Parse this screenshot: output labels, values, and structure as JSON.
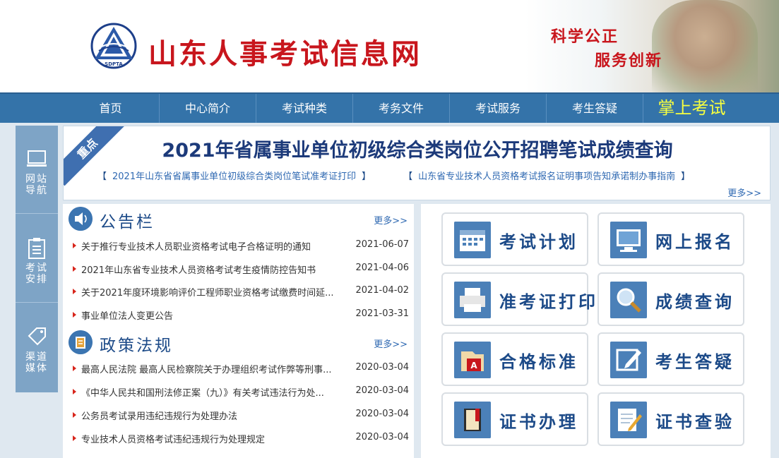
{
  "header": {
    "site_title": "山东人事考试信息网",
    "slogan_line1": "科学公正",
    "slogan_line2": "服务创新",
    "logo_text": "SDPTA"
  },
  "nav": {
    "items": [
      "首页",
      "中心简介",
      "考试种类",
      "考务文件",
      "考试服务",
      "考生答疑",
      "掌上考试"
    ]
  },
  "side": {
    "items": [
      {
        "line1": "网站",
        "line2": "导航",
        "icon": "monitor-icon"
      },
      {
        "line1": "考试",
        "line2": "安排",
        "icon": "clipboard-icon"
      },
      {
        "line1": "渠道",
        "line2": "媒体",
        "icon": "tag-icon"
      }
    ]
  },
  "headline": {
    "ribbon": "重点",
    "title": "2021年省属事业单位初级综合类岗位公开招聘笔试成绩查询",
    "link1": "2021年山东省省属事业单位初级综合类岗位笔试准考证打印",
    "link2": "山东省专业技术人员资格考试报名证明事项告知承诺制办事指南",
    "bracket_open": "【",
    "bracket_close": "】",
    "more": "更多>>"
  },
  "bulletin": {
    "title": "公告栏",
    "more": "更多>>",
    "rows": [
      {
        "title": "关于推行专业技术人员职业资格考试电子合格证明的通知",
        "date": "2021-06-07"
      },
      {
        "title": "2021年山东省专业技术人员资格考试考生疫情防控告知书",
        "date": "2021-04-06"
      },
      {
        "title": "关于2021年度环境影响评价工程师职业资格考试缴费时间延...",
        "date": "2021-04-02"
      },
      {
        "title": "事业单位法人变更公告",
        "date": "2021-03-31"
      }
    ]
  },
  "policy": {
    "title": "政策法规",
    "more": "更多>>",
    "rows": [
      {
        "title": "最高人民法院 最高人民检察院关于办理组织考试作弊等刑事...",
        "date": "2020-03-04"
      },
      {
        "title": "《中华人民共和国刑法修正案（九）》有关考试违法行为处...",
        "date": "2020-03-04"
      },
      {
        "title": "公务员考试录用违纪违规行为处理办法",
        "date": "2020-03-04"
      },
      {
        "title": "专业技术人员资格考试违纪违规行为处理规定",
        "date": "2020-03-04"
      }
    ]
  },
  "services": [
    {
      "label": "考试计划",
      "icon": "calendar-icon"
    },
    {
      "label": "网上报名",
      "icon": "computer-icon"
    },
    {
      "label": "准考证打印",
      "icon": "printer-icon"
    },
    {
      "label": "成绩查询",
      "icon": "magnifier-icon"
    },
    {
      "label": "合格标准",
      "icon": "document-icon"
    },
    {
      "label": "考生答疑",
      "icon": "edit-icon"
    },
    {
      "label": "证书办理",
      "icon": "book-icon"
    },
    {
      "label": "证书查验",
      "icon": "notepad-icon"
    }
  ],
  "colors": {
    "brand_red": "#c8161d",
    "nav_blue": "#3473a9",
    "title_blue": "#1c3a7a",
    "link_blue": "#2f69b2",
    "highlight_yellow": "#f7ff3f"
  }
}
